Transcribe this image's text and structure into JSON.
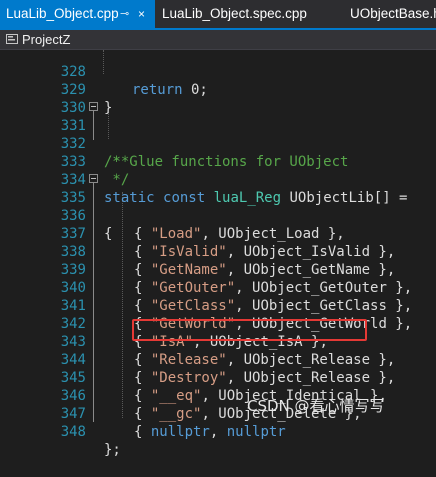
{
  "tabs": [
    {
      "label": "LuaLib_Object.cpp",
      "active": true,
      "pin_icon": "⊸",
      "close_icon": "×"
    },
    {
      "label": "LuaLib_Object.spec.cpp",
      "active": false
    },
    {
      "label": "UObjectBase.h",
      "active": false
    }
  ],
  "navbar": {
    "project": "ProjectZ"
  },
  "colors": {
    "accent": "#007acc",
    "line_number": "#2b91af",
    "keyword": "#569cd6",
    "type": "#4ec9b0",
    "string": "#d69d85",
    "comment": "#57a64a",
    "highlight": "#e53935"
  },
  "code": {
    "l328": {
      "num": "328",
      "kw": "return",
      "rest": " 0;"
    },
    "l329": {
      "num": "329",
      "text": "}"
    },
    "l330": {
      "num": "330"
    },
    "l331": {
      "num": "331",
      "text": "/**"
    },
    "l332": {
      "num": "332",
      "text": " * Glue functions for UObject"
    },
    "l333": {
      "num": "333",
      "text": " */"
    },
    "l334": {
      "num": "334",
      "kw1": "static",
      "kw2": "const",
      "type": "luaL_Reg",
      "rest": " UObjectLib[] ="
    },
    "l335": {
      "num": "335",
      "text": "{"
    },
    "l336": {
      "num": "336",
      "str": "\"Load\"",
      "rest": ", UObject_Load },"
    },
    "l337": {
      "num": "337",
      "str": "\"IsValid\"",
      "rest": ", UObject_IsValid },"
    },
    "l338": {
      "num": "338",
      "str": "\"GetName\"",
      "rest": ", UObject_GetName },"
    },
    "l339": {
      "num": "339",
      "str": "\"GetOuter\"",
      "rest": ", UObject_GetOuter },"
    },
    "l340": {
      "num": "340",
      "str": "\"GetClass\"",
      "rest": ", UObject_GetClass },"
    },
    "l341": {
      "num": "341",
      "str": "\"GetWorld\"",
      "rest": ", UObject_GetWorld },"
    },
    "l342": {
      "num": "342",
      "str": "\"IsA\"",
      "rest": ", UObject_IsA },"
    },
    "l343": {
      "num": "343",
      "str": "\"Release\"",
      "rest": ", UObject_Release },"
    },
    "l344": {
      "num": "344",
      "str": "\"Destroy\"",
      "rest": ", UObject_Release },"
    },
    "l345": {
      "num": "345",
      "str": "\"__eq\"",
      "rest": ", UObject_Identical },"
    },
    "l346": {
      "num": "346",
      "str": "\"__gc\"",
      "rest": ", UObject_Delete },"
    },
    "l347": {
      "num": "347",
      "kw": "nullptr",
      "kw2": "nullptr",
      "mid": ", "
    },
    "l348": {
      "num": "348",
      "text": "};"
    }
  },
  "watermark": "CSDN @看心情写写"
}
